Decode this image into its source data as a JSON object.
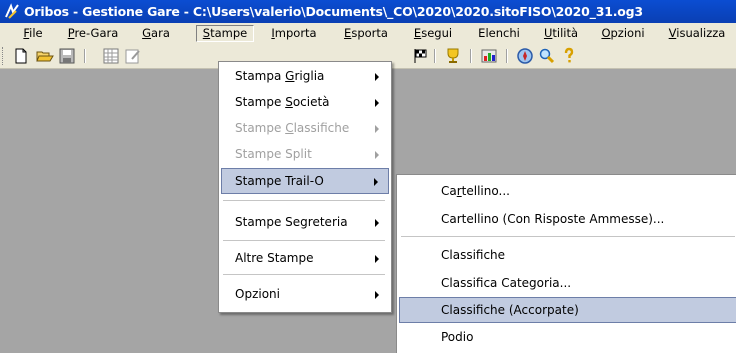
{
  "window": {
    "title": "Oribos - Gestione Gare - C:\\Users\\valerio\\Documents\\_CO\\2020\\2020.sitoFISO\\2020_31.og3"
  },
  "menubar": {
    "items": [
      {
        "label": "File",
        "ul": "F"
      },
      {
        "label": "Pre-Gara",
        "ul": "P"
      },
      {
        "label": "Gara",
        "ul": "G"
      },
      {
        "label": "Stampe",
        "ul": "S"
      },
      {
        "label": "Importa",
        "ul": "I"
      },
      {
        "label": "Esporta",
        "ul": "E"
      },
      {
        "label": "Esegui",
        "ul": "E"
      },
      {
        "label": "Elenchi",
        "ul": ""
      },
      {
        "label": "Utilità",
        "ul": "U"
      },
      {
        "label": "Opzioni",
        "ul": "O"
      },
      {
        "label": "Visualizza",
        "ul": "V"
      }
    ]
  },
  "stampe_menu": {
    "items": [
      {
        "label": "Stampa Griglia",
        "pre": "Stampa ",
        "ul": "G",
        "post": "riglia",
        "disabled": false,
        "submenu": true
      },
      {
        "label": "Stampe Società",
        "pre": "Stampe ",
        "ul": "S",
        "post": "ocietà",
        "disabled": false,
        "submenu": true
      },
      {
        "label": "Stampe Classifiche",
        "pre": "Stampe ",
        "ul": "C",
        "post": "lassifiche",
        "disabled": true,
        "submenu": true
      },
      {
        "label": "Stampe Split",
        "pre": "Stampe Split",
        "ul": "",
        "post": "",
        "disabled": true,
        "submenu": true
      },
      {
        "label": "Stampe Trail-O",
        "pre": "Stampe Trail-O",
        "ul": "",
        "post": "",
        "disabled": false,
        "submenu": true,
        "highlighted": true
      },
      {
        "label": "Stampe Segreteria",
        "pre": "Stampe Segreteria",
        "ul": "",
        "post": "",
        "disabled": false,
        "submenu": true
      },
      {
        "label": "Altre Stampe",
        "pre": "Altre Stampe",
        "ul": "",
        "post": "",
        "disabled": false,
        "submenu": true
      },
      {
        "label": "Opzioni",
        "pre": "Opzioni",
        "ul": "",
        "post": "",
        "disabled": false,
        "submenu": true
      }
    ]
  },
  "trailo_menu": {
    "items": [
      {
        "label": "Cartellino...",
        "pre": "Ca",
        "ul": "r",
        "post": "tellino..."
      },
      {
        "label": "Cartellino (Con Risposte Ammesse)...",
        "pre": "Cartellino (Con Risposte Ammesse)...",
        "ul": "",
        "post": ""
      },
      {
        "label": "Classifiche",
        "pre": "Classifiche",
        "ul": "",
        "post": ""
      },
      {
        "label": "Classifica Categoria...",
        "pre": "Classifica Categoria...",
        "ul": "",
        "post": ""
      },
      {
        "label": "Classifiche (Accorpate)",
        "pre": "Classifiche (Accorpate)",
        "ul": "",
        "post": "",
        "highlighted": true
      },
      {
        "label": "Podio",
        "pre": "Podio",
        "ul": "",
        "post": ""
      }
    ]
  },
  "toolbar": {
    "icons": [
      "new-file-icon",
      "open-folder-icon",
      "save-icon",
      "grid-icon",
      "edit-icon",
      "checkered-flag-icon",
      "trophy-icon",
      "chart-icon",
      "compass-icon",
      "magnifier-icon",
      "help-icon"
    ]
  }
}
